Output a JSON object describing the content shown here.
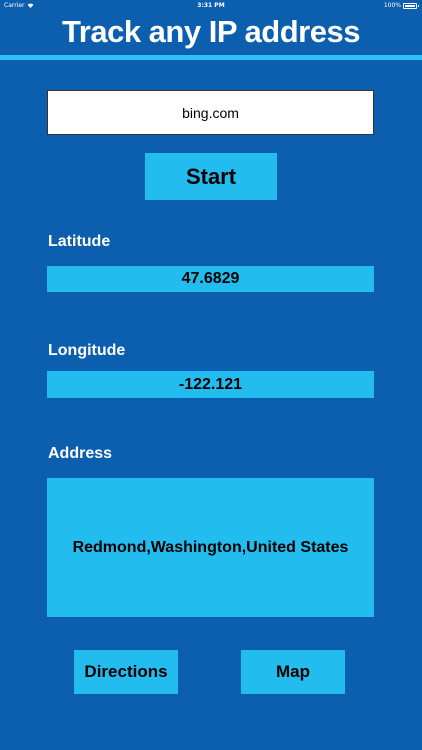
{
  "status_bar": {
    "carrier": "Carrier",
    "time": "3:31 PM",
    "battery": "100%"
  },
  "header": {
    "title": "Track any IP address"
  },
  "search": {
    "value": "bing.com"
  },
  "actions": {
    "start_label": "Start",
    "directions_label": "Directions",
    "map_label": "Map"
  },
  "latitude": {
    "label": "Latitude",
    "value": "47.6829"
  },
  "longitude": {
    "label": "Longitude",
    "value": "-122.121"
  },
  "address": {
    "label": "Address",
    "value": "Redmond,Washington,United States"
  },
  "colors": {
    "background": "#0c5fae",
    "accent": "#23bcef",
    "rule": "#2ec0f2"
  },
  "icons": [
    "wifi-icon",
    "battery-icon"
  ]
}
